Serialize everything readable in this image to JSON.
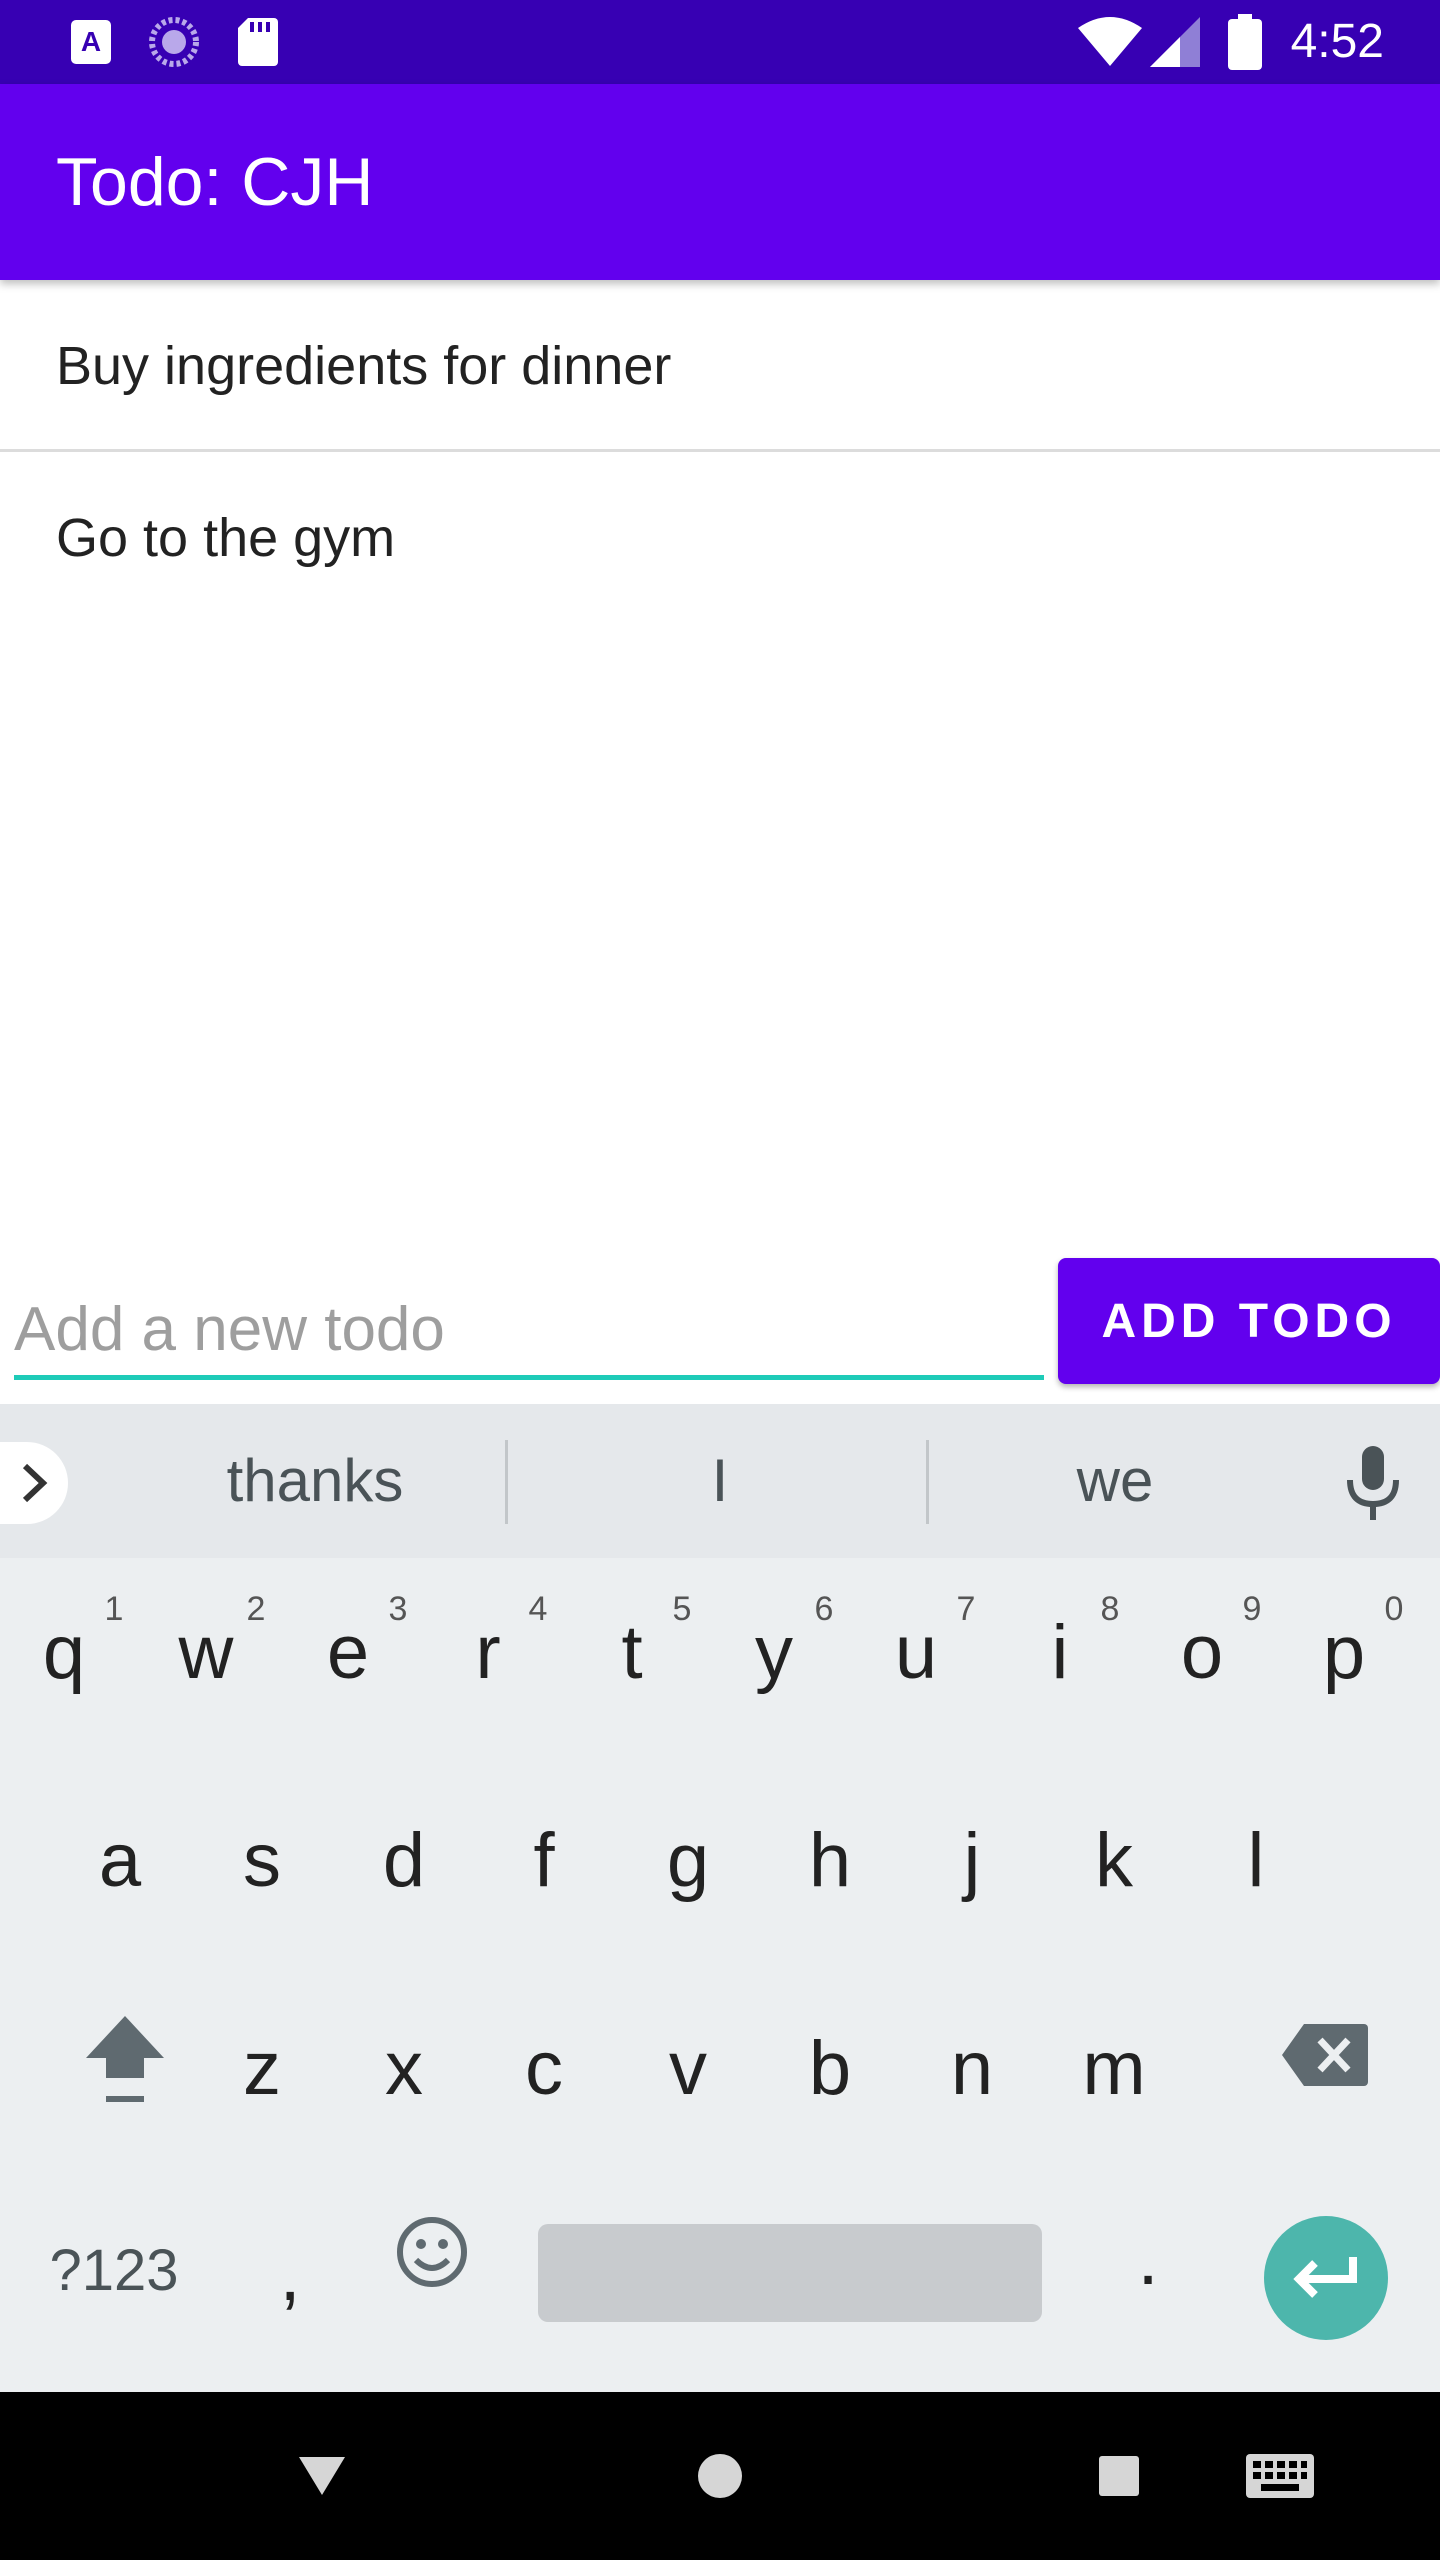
{
  "status_bar": {
    "time": "4:52",
    "left_icons": [
      "font-a-icon",
      "progress-circle-icon",
      "sd-card-icon"
    ],
    "right_icons": [
      "wifi-icon",
      "signal-icon",
      "battery-icon"
    ]
  },
  "app_bar": {
    "title": "Todo: CJH"
  },
  "todos": [
    {
      "text": "Buy ingredients for dinner"
    },
    {
      "text": "Go to the gym"
    }
  ],
  "input": {
    "placeholder": "Add a new todo",
    "value": ""
  },
  "add_button": {
    "label": "ADD TODO"
  },
  "keyboard": {
    "suggestions": [
      "thanks",
      "I",
      "we"
    ],
    "row1": [
      {
        "key": "q",
        "hint": "1"
      },
      {
        "key": "w",
        "hint": "2"
      },
      {
        "key": "e",
        "hint": "3"
      },
      {
        "key": "r",
        "hint": "4"
      },
      {
        "key": "t",
        "hint": "5"
      },
      {
        "key": "y",
        "hint": "6"
      },
      {
        "key": "u",
        "hint": "7"
      },
      {
        "key": "i",
        "hint": "8"
      },
      {
        "key": "o",
        "hint": "9"
      },
      {
        "key": "p",
        "hint": "0"
      }
    ],
    "row2": [
      "a",
      "s",
      "d",
      "f",
      "g",
      "h",
      "j",
      "k",
      "l"
    ],
    "row3": [
      "z",
      "x",
      "c",
      "v",
      "b",
      "n",
      "m"
    ],
    "symbols_label": "?123",
    "comma": ",",
    "period": "."
  },
  "colors": {
    "status_bar": "#3700B3",
    "primary": "#6200EE",
    "accent": "#1ECBB8",
    "enter_key": "#4DB6AC"
  }
}
